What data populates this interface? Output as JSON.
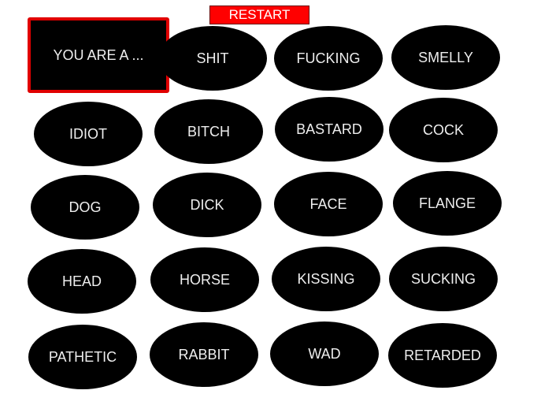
{
  "restart_label": "RESTART",
  "sentence": "YOU ARE A ...",
  "words": [
    "SHIT",
    "FUCKING",
    "SMELLY",
    "IDIOT",
    "BITCH",
    "BASTARD",
    "COCK",
    "DOG",
    "DICK",
    "FACE",
    "FLANGE",
    "HEAD",
    "HORSE",
    "KISSING",
    "SUCKING",
    "PATHETIC",
    "RABBIT",
    "WAD",
    "RETARDED"
  ],
  "colors": {
    "restart_bg": "#ff0000",
    "sentence_border": "#e00000",
    "word_bg": "#000000"
  }
}
